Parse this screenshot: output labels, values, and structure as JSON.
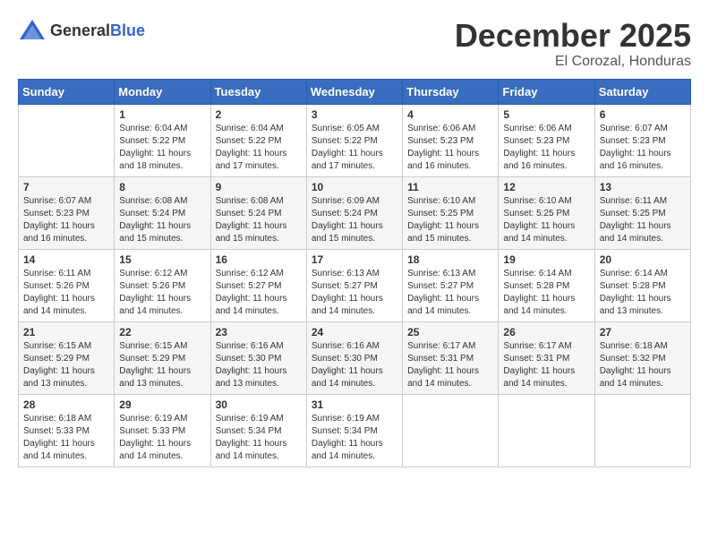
{
  "logo": {
    "general": "General",
    "blue": "Blue"
  },
  "title": {
    "month": "December 2025",
    "location": "El Corozal, Honduras"
  },
  "weekdays": [
    "Sunday",
    "Monday",
    "Tuesday",
    "Wednesday",
    "Thursday",
    "Friday",
    "Saturday"
  ],
  "weeks": [
    [
      {
        "day": "",
        "sunrise": "",
        "sunset": "",
        "daylight": ""
      },
      {
        "day": "1",
        "sunrise": "Sunrise: 6:04 AM",
        "sunset": "Sunset: 5:22 PM",
        "daylight": "Daylight: 11 hours and 18 minutes."
      },
      {
        "day": "2",
        "sunrise": "Sunrise: 6:04 AM",
        "sunset": "Sunset: 5:22 PM",
        "daylight": "Daylight: 11 hours and 17 minutes."
      },
      {
        "day": "3",
        "sunrise": "Sunrise: 6:05 AM",
        "sunset": "Sunset: 5:22 PM",
        "daylight": "Daylight: 11 hours and 17 minutes."
      },
      {
        "day": "4",
        "sunrise": "Sunrise: 6:06 AM",
        "sunset": "Sunset: 5:23 PM",
        "daylight": "Daylight: 11 hours and 16 minutes."
      },
      {
        "day": "5",
        "sunrise": "Sunrise: 6:06 AM",
        "sunset": "Sunset: 5:23 PM",
        "daylight": "Daylight: 11 hours and 16 minutes."
      },
      {
        "day": "6",
        "sunrise": "Sunrise: 6:07 AM",
        "sunset": "Sunset: 5:23 PM",
        "daylight": "Daylight: 11 hours and 16 minutes."
      }
    ],
    [
      {
        "day": "7",
        "sunrise": "Sunrise: 6:07 AM",
        "sunset": "Sunset: 5:23 PM",
        "daylight": "Daylight: 11 hours and 16 minutes."
      },
      {
        "day": "8",
        "sunrise": "Sunrise: 6:08 AM",
        "sunset": "Sunset: 5:24 PM",
        "daylight": "Daylight: 11 hours and 15 minutes."
      },
      {
        "day": "9",
        "sunrise": "Sunrise: 6:08 AM",
        "sunset": "Sunset: 5:24 PM",
        "daylight": "Daylight: 11 hours and 15 minutes."
      },
      {
        "day": "10",
        "sunrise": "Sunrise: 6:09 AM",
        "sunset": "Sunset: 5:24 PM",
        "daylight": "Daylight: 11 hours and 15 minutes."
      },
      {
        "day": "11",
        "sunrise": "Sunrise: 6:10 AM",
        "sunset": "Sunset: 5:25 PM",
        "daylight": "Daylight: 11 hours and 15 minutes."
      },
      {
        "day": "12",
        "sunrise": "Sunrise: 6:10 AM",
        "sunset": "Sunset: 5:25 PM",
        "daylight": "Daylight: 11 hours and 14 minutes."
      },
      {
        "day": "13",
        "sunrise": "Sunrise: 6:11 AM",
        "sunset": "Sunset: 5:25 PM",
        "daylight": "Daylight: 11 hours and 14 minutes."
      }
    ],
    [
      {
        "day": "14",
        "sunrise": "Sunrise: 6:11 AM",
        "sunset": "Sunset: 5:26 PM",
        "daylight": "Daylight: 11 hours and 14 minutes."
      },
      {
        "day": "15",
        "sunrise": "Sunrise: 6:12 AM",
        "sunset": "Sunset: 5:26 PM",
        "daylight": "Daylight: 11 hours and 14 minutes."
      },
      {
        "day": "16",
        "sunrise": "Sunrise: 6:12 AM",
        "sunset": "Sunset: 5:27 PM",
        "daylight": "Daylight: 11 hours and 14 minutes."
      },
      {
        "day": "17",
        "sunrise": "Sunrise: 6:13 AM",
        "sunset": "Sunset: 5:27 PM",
        "daylight": "Daylight: 11 hours and 14 minutes."
      },
      {
        "day": "18",
        "sunrise": "Sunrise: 6:13 AM",
        "sunset": "Sunset: 5:27 PM",
        "daylight": "Daylight: 11 hours and 14 minutes."
      },
      {
        "day": "19",
        "sunrise": "Sunrise: 6:14 AM",
        "sunset": "Sunset: 5:28 PM",
        "daylight": "Daylight: 11 hours and 14 minutes."
      },
      {
        "day": "20",
        "sunrise": "Sunrise: 6:14 AM",
        "sunset": "Sunset: 5:28 PM",
        "daylight": "Daylight: 11 hours and 13 minutes."
      }
    ],
    [
      {
        "day": "21",
        "sunrise": "Sunrise: 6:15 AM",
        "sunset": "Sunset: 5:29 PM",
        "daylight": "Daylight: 11 hours and 13 minutes."
      },
      {
        "day": "22",
        "sunrise": "Sunrise: 6:15 AM",
        "sunset": "Sunset: 5:29 PM",
        "daylight": "Daylight: 11 hours and 13 minutes."
      },
      {
        "day": "23",
        "sunrise": "Sunrise: 6:16 AM",
        "sunset": "Sunset: 5:30 PM",
        "daylight": "Daylight: 11 hours and 13 minutes."
      },
      {
        "day": "24",
        "sunrise": "Sunrise: 6:16 AM",
        "sunset": "Sunset: 5:30 PM",
        "daylight": "Daylight: 11 hours and 14 minutes."
      },
      {
        "day": "25",
        "sunrise": "Sunrise: 6:17 AM",
        "sunset": "Sunset: 5:31 PM",
        "daylight": "Daylight: 11 hours and 14 minutes."
      },
      {
        "day": "26",
        "sunrise": "Sunrise: 6:17 AM",
        "sunset": "Sunset: 5:31 PM",
        "daylight": "Daylight: 11 hours and 14 minutes."
      },
      {
        "day": "27",
        "sunrise": "Sunrise: 6:18 AM",
        "sunset": "Sunset: 5:32 PM",
        "daylight": "Daylight: 11 hours and 14 minutes."
      }
    ],
    [
      {
        "day": "28",
        "sunrise": "Sunrise: 6:18 AM",
        "sunset": "Sunset: 5:33 PM",
        "daylight": "Daylight: 11 hours and 14 minutes."
      },
      {
        "day": "29",
        "sunrise": "Sunrise: 6:19 AM",
        "sunset": "Sunset: 5:33 PM",
        "daylight": "Daylight: 11 hours and 14 minutes."
      },
      {
        "day": "30",
        "sunrise": "Sunrise: 6:19 AM",
        "sunset": "Sunset: 5:34 PM",
        "daylight": "Daylight: 11 hours and 14 minutes."
      },
      {
        "day": "31",
        "sunrise": "Sunrise: 6:19 AM",
        "sunset": "Sunset: 5:34 PM",
        "daylight": "Daylight: 11 hours and 14 minutes."
      },
      {
        "day": "",
        "sunrise": "",
        "sunset": "",
        "daylight": ""
      },
      {
        "day": "",
        "sunrise": "",
        "sunset": "",
        "daylight": ""
      },
      {
        "day": "",
        "sunrise": "",
        "sunset": "",
        "daylight": ""
      }
    ]
  ]
}
